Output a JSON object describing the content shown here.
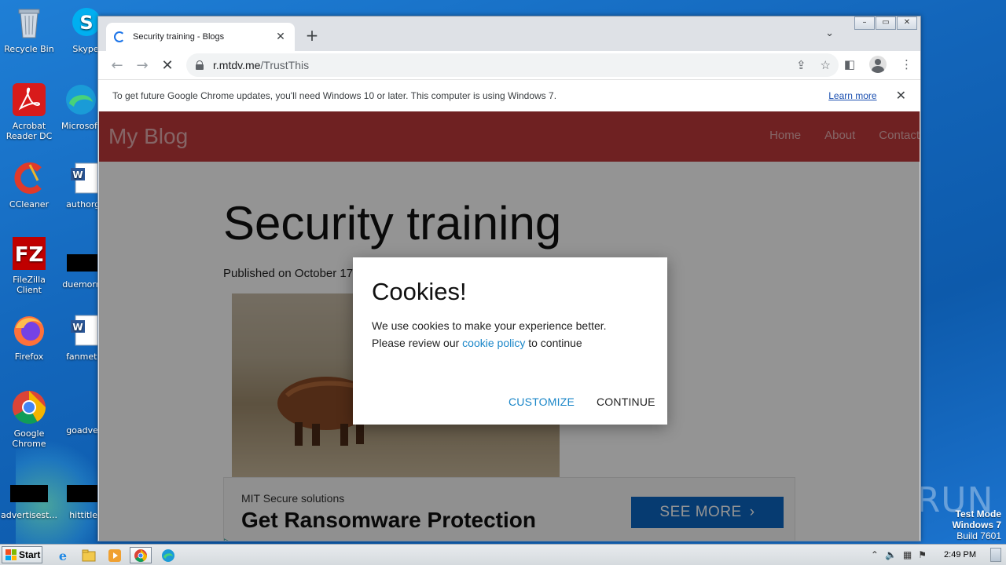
{
  "desktop": {
    "icons": [
      {
        "label": "Recycle Bin",
        "icon": "recycle-bin-icon"
      },
      {
        "label": "Skype",
        "icon": "skype-icon"
      },
      {
        "label": "Acrobat Reader DC",
        "icon": "acrobat-icon"
      },
      {
        "label": "Microsoft",
        "icon": "edge-icon"
      },
      {
        "label": "CCleaner",
        "icon": "ccleaner-icon"
      },
      {
        "label": "authorgo",
        "icon": "word-doc-icon"
      },
      {
        "label": "FileZilla Client",
        "icon": "filezilla-icon"
      },
      {
        "label": "duemornin",
        "icon": "blank-file-icon"
      },
      {
        "label": "Firefox",
        "icon": "firefox-icon"
      },
      {
        "label": "fanmet...",
        "icon": "word-doc-icon"
      },
      {
        "label": "Google Chrome",
        "icon": "chrome-icon"
      },
      {
        "label": "goadvert",
        "icon": "blank-file-icon"
      },
      {
        "label": "advertisest...",
        "icon": "blank-file-icon"
      },
      {
        "label": "hittitles",
        "icon": "blank-file-icon"
      }
    ],
    "watermark": "ANY▷RUN",
    "testmode": {
      "line1": "Test Mode",
      "line2": "Windows 7",
      "line3": "Build 7601"
    }
  },
  "browser": {
    "tab_title": "Security training - Blogs",
    "url_host": "r.mtdv.me",
    "url_path": "/TrustThis",
    "infobar_message": "To get future Google Chrome updates, you'll need Windows 10 or later. This computer is using Windows 7.",
    "infobar_link": "Learn more"
  },
  "page": {
    "brand": "My Blog",
    "nav": [
      "Home",
      "About",
      "Contact"
    ],
    "title": "Security training",
    "published": "Published on October 17,",
    "ad": {
      "brand": "MIT Secure solutions",
      "headline": "Get Ransomware Protection",
      "cta": "SEE MORE"
    }
  },
  "modal": {
    "title": "Cookies!",
    "line1": "We use cookies to make your experience better.",
    "line2_pre": "Please review our ",
    "line2_link": "cookie policy",
    "line2_post": " to continue",
    "customize": "CUSTOMIZE",
    "continue": "CONTINUE"
  },
  "taskbar": {
    "start": "Start",
    "clock": "2:49 PM"
  },
  "colors": {
    "blog_nav": "#c0393b",
    "link": "#1a86c8",
    "ad_cta": "#0b66c3"
  }
}
